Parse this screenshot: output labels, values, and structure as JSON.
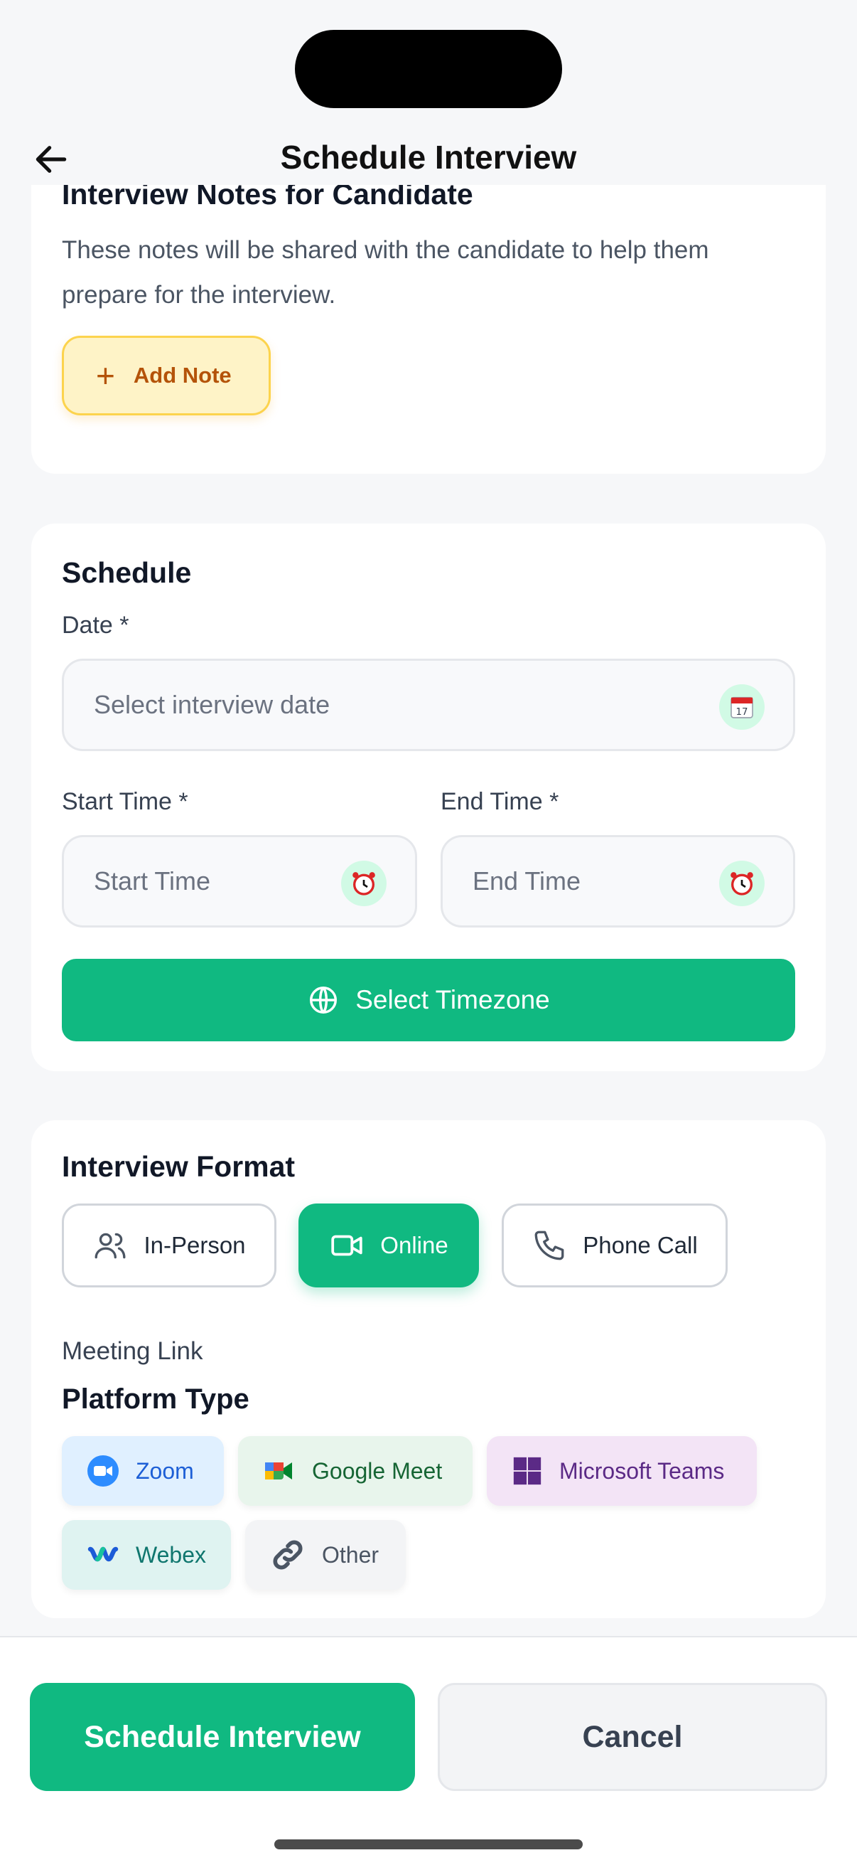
{
  "header": {
    "title": "Schedule Interview"
  },
  "notes": {
    "heading": "Interview Notes for Candidate",
    "description": "These notes will be shared with the candidate to help them prepare for the interview.",
    "add_note_label": "Add Note"
  },
  "schedule": {
    "heading": "Schedule",
    "date_label": "Date *",
    "date_placeholder": "Select interview date",
    "start_label": "Start Time *",
    "start_placeholder": "Start Time",
    "end_label": "End Time *",
    "end_placeholder": "End Time",
    "timezone_label": "Select Timezone",
    "icons": {
      "date": "calendar-icon",
      "time": "alarm-clock-icon",
      "timezone": "globe-icon"
    }
  },
  "format": {
    "heading": "Interview Format",
    "options": [
      {
        "label": "In-Person",
        "icon": "users-icon",
        "selected": false
      },
      {
        "label": "Online",
        "icon": "video-icon",
        "selected": true
      },
      {
        "label": "Phone Call",
        "icon": "phone-icon",
        "selected": false
      }
    ],
    "meeting_link_label": "Meeting Link",
    "platform_type_label": "Platform Type",
    "platforms": [
      {
        "label": "Zoom",
        "icon": "zoom-icon",
        "bg": "#e0f0ff",
        "color": "#1d5fd6"
      },
      {
        "label": "Google Meet",
        "icon": "google-meet-icon",
        "bg": "#e8f5ec",
        "color": "#166534"
      },
      {
        "label": "Microsoft Teams",
        "icon": "microsoft-teams-icon",
        "bg": "#f3e4f6",
        "color": "#5b2a86"
      },
      {
        "label": "Webex",
        "icon": "webex-icon",
        "bg": "#dff3f1",
        "color": "#0f766e"
      },
      {
        "label": "Other",
        "icon": "link-icon",
        "bg": "#f3f4f6",
        "color": "#4b5563"
      }
    ]
  },
  "footer": {
    "primary_label": "Schedule Interview",
    "secondary_label": "Cancel"
  },
  "colors": {
    "accent": "#10b981",
    "warning_bg": "#fef3c7",
    "warning_text": "#b45309"
  }
}
